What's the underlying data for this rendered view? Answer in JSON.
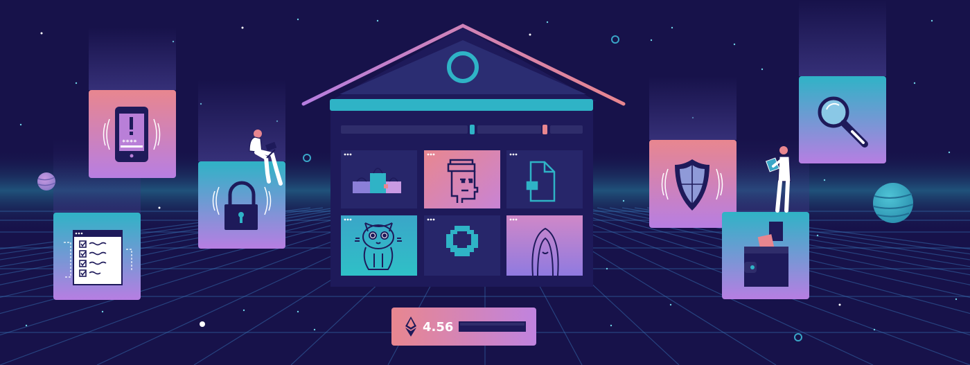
{
  "price_card": {
    "value": "4.56",
    "currency_icon": "ethereum-icon"
  },
  "phone_card": {
    "icon": "alert-phone-icon",
    "password_mask": "****"
  },
  "cards": [
    {
      "name": "security-alert-card",
      "icon": "phone-alert-icon"
    },
    {
      "name": "checklist-card",
      "icon": "checklist-icon"
    },
    {
      "name": "lock-card",
      "icon": "padlock-icon"
    },
    {
      "name": "shield-card",
      "icon": "shield-icon"
    },
    {
      "name": "search-card",
      "icon": "magnifier-icon"
    },
    {
      "name": "wallet-card",
      "icon": "wallet-icon"
    }
  ],
  "nft_tiles": [
    "shopping-bags-icon",
    "pixel-punk-icon",
    "document-icon",
    "cat-icon",
    "pixel-ring-icon",
    "portrait-icon"
  ],
  "colors": {
    "background": "#17124a",
    "pink": "#e8868f",
    "purple": "#b67ee0",
    "teal": "#2fb3c6",
    "building": "#1e1a5a",
    "roof_outline_left": "#b67ee0",
    "roof_outline_right": "#e8868f"
  }
}
